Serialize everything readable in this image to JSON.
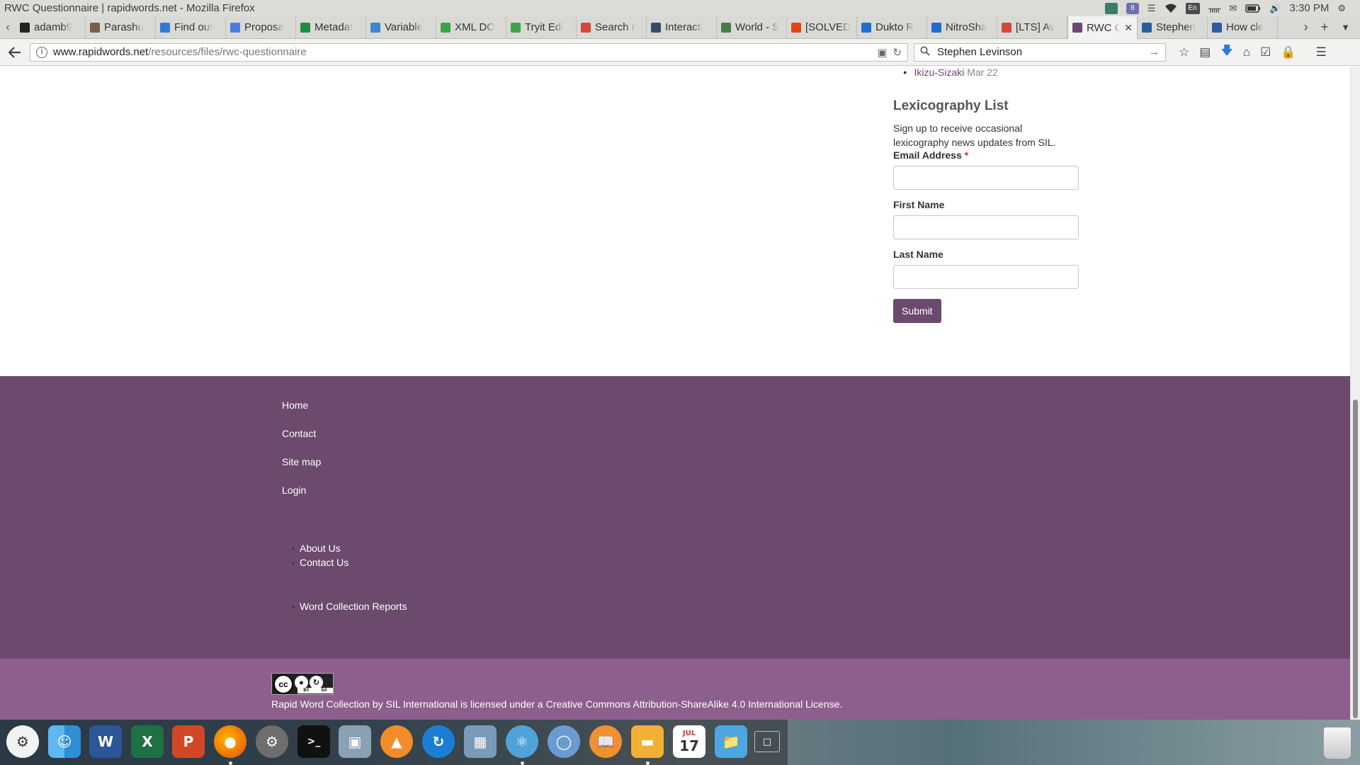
{
  "os": {
    "window_title": "RWC Questionnaire | rapidwords.net - Mozilla Firefox",
    "keyboard_layout": "En",
    "time": "3:30 PM"
  },
  "browser": {
    "tabs": [
      {
        "label": "adamb9",
        "favicon": "github-icon",
        "color": "#222222"
      },
      {
        "label": "Parashu",
        "favicon": "avatar-icon",
        "color": "#7a5d4a"
      },
      {
        "label": "Find out",
        "favicon": "loading-icon",
        "color": "#2f7ad9"
      },
      {
        "label": "Proposa",
        "favicon": "docs-icon",
        "color": "#4a7ee0"
      },
      {
        "label": "Metadat",
        "favicon": "sheets-icon",
        "color": "#1e8e3e"
      },
      {
        "label": "Variable",
        "favicon": "page-icon",
        "color": "#3a87c9"
      },
      {
        "label": "XML DO",
        "favicon": "w3-icon",
        "color": "#3da34a"
      },
      {
        "label": "Tryit Edi",
        "favicon": "w3-icon",
        "color": "#3da34a"
      },
      {
        "label": "Search r",
        "favicon": "gmail-icon",
        "color": "#d44638"
      },
      {
        "label": "Interacti",
        "favicon": "page-icon",
        "color": "#3a4a6a"
      },
      {
        "label": "World - S",
        "favicon": "globe-icon",
        "color": "#4a7a4a"
      },
      {
        "label": "[SOLVED",
        "favicon": "ubuntu-icon",
        "color": "#dd4814"
      },
      {
        "label": "Dukto R",
        "favicon": "letter-a-icon",
        "color": "#1f6ed4"
      },
      {
        "label": "NitroSha",
        "favicon": "letter-a-icon",
        "color": "#1f6ed4"
      },
      {
        "label": "[LTS] Av",
        "favicon": "gmail-icon",
        "color": "#d44638"
      },
      {
        "label": "RWC Q",
        "favicon": "rwc-icon",
        "color": "#6b4a6e",
        "active": true
      },
      {
        "label": "Stephen",
        "favicon": "sil-icon",
        "color": "#2a5d9f"
      },
      {
        "label": "How cle",
        "favicon": "x-icon",
        "color": "#2a5d9f"
      }
    ],
    "url_host": "www.rapidwords.net",
    "url_path": "/resources/files/rwc-questionnaire",
    "search_value": "Stephen Levinson"
  },
  "page": {
    "recent_item": {
      "label": "Ikizu-Sizaki",
      "date": "Mar 22"
    },
    "signup": {
      "title": "Lexicography List",
      "description": "Sign up to receive occasional lexicography news updates from SIL.",
      "email_label": "Email Address",
      "required_mark": "*",
      "first_name_label": "First Name",
      "last_name_label": "Last Name",
      "submit_label": "Submit"
    },
    "footer_nav": [
      "Home",
      "Contact",
      "Site map",
      "Login"
    ],
    "footer_links_1": [
      "About Us",
      "Contact Us"
    ],
    "footer_links_2": [
      "Word Collection Reports"
    ],
    "license": {
      "badge_text": "cc",
      "badge_labels": [
        "BY",
        "SA"
      ],
      "work": "Rapid Word Collection",
      "by": "by",
      "author": "SIL International",
      "middle": "is licensed under a",
      "license_name": "Creative Commons Attribution-ShareAlike 4.0 International License",
      "end": "."
    }
  },
  "dock": {
    "calendar_month": "JUL",
    "calendar_day": "17",
    "apps": [
      "ubuntu-launcher",
      "finder",
      "word",
      "excel",
      "powerpoint",
      "firefox",
      "system-preferences",
      "terminal",
      "preview",
      "vlc",
      "update",
      "image-viewer",
      "atom",
      "chromium",
      "books",
      "notes",
      "calendar",
      "files",
      "workspace"
    ]
  },
  "colors": {
    "footer_main": "#6b4a6e",
    "footer_bottom": "#8d5f8c",
    "accent": "#6b4a6e"
  }
}
